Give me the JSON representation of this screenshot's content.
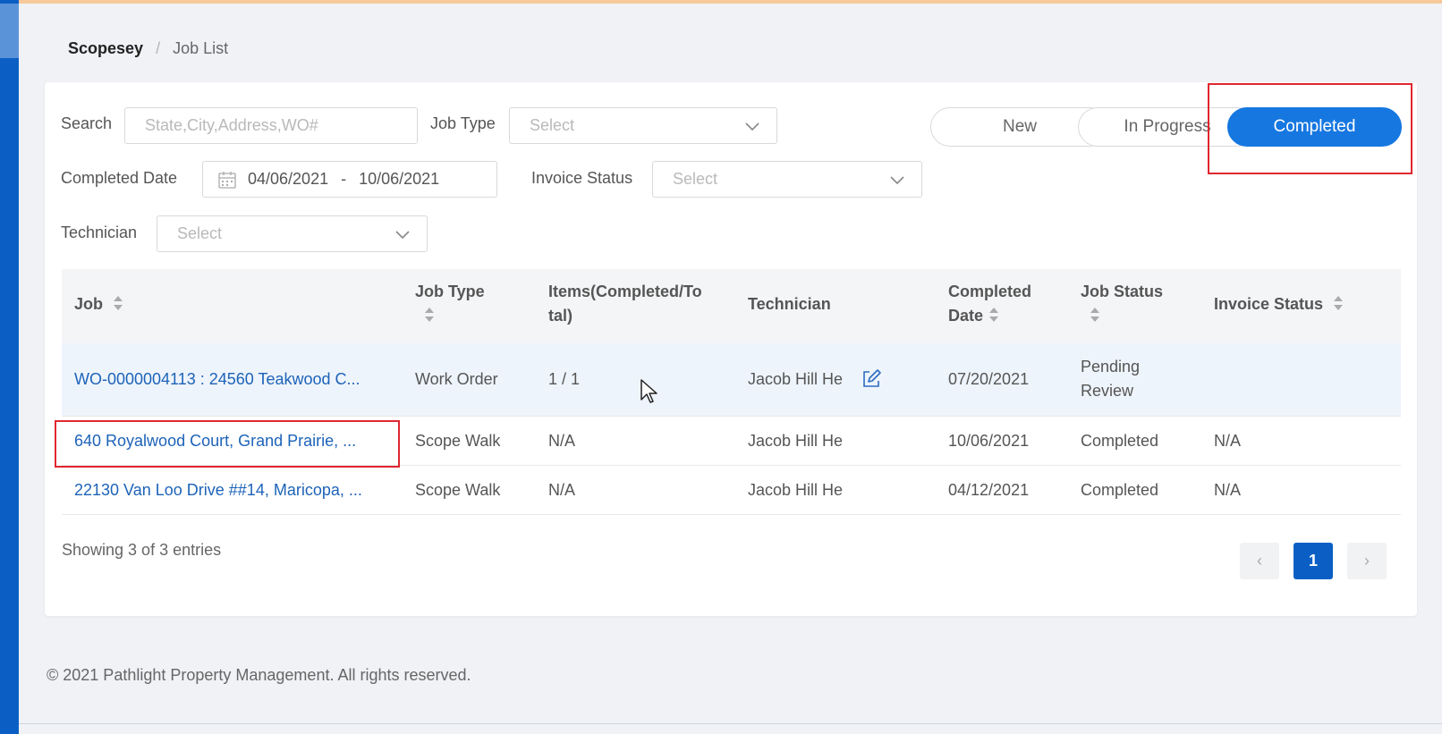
{
  "breadcrumb": {
    "root": "Scopesey",
    "separator": "/",
    "current": "Job List"
  },
  "filters": {
    "search_label": "Search",
    "search_placeholder": "State,City,Address,WO#",
    "job_type_label": "Job Type",
    "job_type_value": "Select",
    "completed_date_label": "Completed Date",
    "date_from": "04/06/2021",
    "date_separator": "-",
    "date_to": "10/06/2021",
    "invoice_status_label": "Invoice Status",
    "invoice_status_value": "Select",
    "technician_label": "Technician",
    "technician_value": "Select"
  },
  "status_tabs": {
    "new": "New",
    "in_progress": "In Progress",
    "completed": "Completed",
    "active": "completed"
  },
  "table": {
    "headers": {
      "job": "Job",
      "job_type_line1": "Job Type",
      "items_line1": "Items(Completed/To",
      "items_line2": "tal)",
      "technician": "Technician",
      "completed_date_line1": "Completed",
      "completed_date_line2": "Date",
      "job_status": "Job Status",
      "invoice_status": "Invoice Status"
    },
    "rows": [
      {
        "job": "WO-0000004113 : 24560 Teakwood C...",
        "job_type": "Work Order",
        "items": "1 / 1",
        "technician": "Jacob Hill He",
        "completed_date": "07/20/2021",
        "job_status_line1": "Pending",
        "job_status_line2": "Review",
        "invoice_status": ""
      },
      {
        "job": "640 Royalwood Court, Grand Prairie, ...",
        "job_type": "Scope Walk",
        "items": "N/A",
        "technician": "Jacob Hill He",
        "completed_date": "10/06/2021",
        "job_status_line1": "Completed",
        "job_status_line2": "",
        "invoice_status": "N/A"
      },
      {
        "job": "22130 Van Loo Drive ##14, Maricopa, ...",
        "job_type": "Scope Walk",
        "items": "N/A",
        "technician": "Jacob Hill He",
        "completed_date": "04/12/2021",
        "job_status_line1": "Completed",
        "job_status_line2": "",
        "invoice_status": "N/A"
      }
    ]
  },
  "pagination": {
    "showing": "Showing 3 of 3 entries",
    "prev": "‹",
    "current_page": "1",
    "next": "›"
  },
  "footer": {
    "copyright": "© 2021 Pathlight Property Management. All rights reserved."
  },
  "colors": {
    "primary": "#1677e0",
    "rail": "#0b5fc4",
    "link": "#1d63b8",
    "highlight": "#e0262f",
    "accent": "#f7c99a"
  }
}
